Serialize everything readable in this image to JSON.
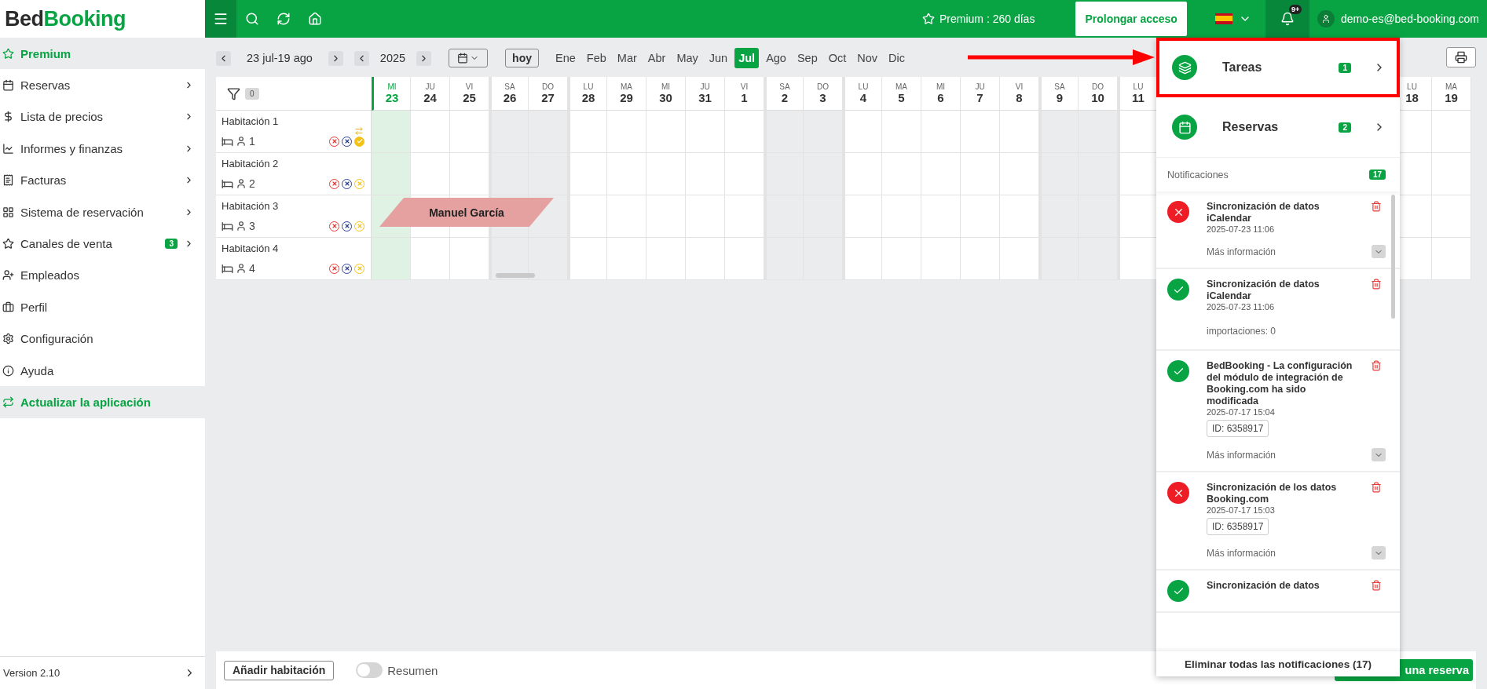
{
  "logo": {
    "dark": "Bed",
    "green": "Booking"
  },
  "topbar": {
    "premium": "Premium : 260 días",
    "extend_button": "Prolongar acceso",
    "notifications_badge": "9+",
    "notifications_open": true,
    "user": "demo-es@bed-booking.com"
  },
  "sidebar": {
    "items": [
      {
        "label": "Premium",
        "highlighted": true,
        "submenu": false
      },
      {
        "label": "Reservas",
        "highlighted": false,
        "submenu": true
      },
      {
        "label": "Lista de precios",
        "highlighted": false,
        "submenu": true
      },
      {
        "label": "Informes y finanzas",
        "highlighted": false,
        "submenu": true
      },
      {
        "label": "Facturas",
        "highlighted": false,
        "submenu": true
      },
      {
        "label": "Sistema de reservación",
        "highlighted": false,
        "submenu": true
      },
      {
        "label": "Canales de venta",
        "highlighted": false,
        "submenu": true,
        "badge": "3"
      },
      {
        "label": "Empleados",
        "highlighted": false,
        "submenu": false
      },
      {
        "label": "Perfil",
        "highlighted": false,
        "submenu": false
      },
      {
        "label": "Configuración",
        "highlighted": false,
        "submenu": false
      },
      {
        "label": "Ayuda",
        "highlighted": false,
        "submenu": false
      },
      {
        "label": "Actualizar la aplicación",
        "highlighted": true,
        "submenu": false
      }
    ],
    "version": "Version 2.10"
  },
  "toolbar": {
    "range": "23 jul-19 ago",
    "year": "2025",
    "today_button": "hoy",
    "months": [
      {
        "label": "Ene",
        "selected": false
      },
      {
        "label": "Feb",
        "selected": false
      },
      {
        "label": "Mar",
        "selected": false
      },
      {
        "label": "Abr",
        "selected": false
      },
      {
        "label": "May",
        "selected": false
      },
      {
        "label": "Jun",
        "selected": false
      },
      {
        "label": "Jul",
        "selected": true
      },
      {
        "label": "Ago",
        "selected": false
      },
      {
        "label": "Sep",
        "selected": false
      },
      {
        "label": "Oct",
        "selected": false
      },
      {
        "label": "Nov",
        "selected": false
      },
      {
        "label": "Dic",
        "selected": false
      }
    ]
  },
  "calendar": {
    "filter_count": "0",
    "days": [
      {
        "weekday": "MI",
        "day": "23",
        "weekend": false,
        "selected": true
      },
      {
        "weekday": "JU",
        "day": "24",
        "weekend": false,
        "selected": false
      },
      {
        "weekday": "VI",
        "day": "25",
        "weekend": false,
        "selected": false
      },
      {
        "weekday": "SA",
        "day": "26",
        "weekend": true,
        "selected": false
      },
      {
        "weekday": "DO",
        "day": "27",
        "weekend": true,
        "selected": false
      },
      {
        "weekday": "LU",
        "day": "28",
        "weekend": false,
        "selected": false
      },
      {
        "weekday": "MA",
        "day": "29",
        "weekend": false,
        "selected": false
      },
      {
        "weekday": "MI",
        "day": "30",
        "weekend": false,
        "selected": false
      },
      {
        "weekday": "JU",
        "day": "31",
        "weekend": false,
        "selected": false
      },
      {
        "weekday": "VI",
        "day": "1",
        "weekend": false,
        "selected": false
      },
      {
        "weekday": "SA",
        "day": "2",
        "weekend": true,
        "selected": false
      },
      {
        "weekday": "DO",
        "day": "3",
        "weekend": true,
        "selected": false
      },
      {
        "weekday": "LU",
        "day": "4",
        "weekend": false,
        "selected": false
      },
      {
        "weekday": "MA",
        "day": "5",
        "weekend": false,
        "selected": false
      },
      {
        "weekday": "MI",
        "day": "6",
        "weekend": false,
        "selected": false
      },
      {
        "weekday": "JU",
        "day": "7",
        "weekend": false,
        "selected": false
      },
      {
        "weekday": "VI",
        "day": "8",
        "weekend": false,
        "selected": false
      },
      {
        "weekday": "SA",
        "day": "9",
        "weekend": true,
        "selected": false
      },
      {
        "weekday": "DO",
        "day": "10",
        "weekend": true,
        "selected": false
      },
      {
        "weekday": "LU",
        "day": "11",
        "weekend": false,
        "selected": false
      },
      {
        "weekday": "LU",
        "day": "18",
        "weekend": false,
        "selected": false
      },
      {
        "weekday": "MA",
        "day": "19",
        "weekend": false,
        "selected": false
      }
    ],
    "rooms": [
      {
        "name": "Habitación 1",
        "capacity": "1",
        "transfer": true,
        "statuses": [
          {
            "color": "#e53935",
            "ok": false
          },
          {
            "color": "#2a3f8f",
            "ok": false
          },
          {
            "color": "#f2c218",
            "ok": true
          }
        ]
      },
      {
        "name": "Habitación 2",
        "capacity": "2",
        "transfer": false,
        "statuses": [
          {
            "color": "#e53935",
            "ok": false
          },
          {
            "color": "#2a3f8f",
            "ok": false
          },
          {
            "color": "#f2c218",
            "ok": false
          }
        ]
      },
      {
        "name": "Habitación 3",
        "capacity": "3",
        "transfer": false,
        "statuses": [
          {
            "color": "#e53935",
            "ok": false
          },
          {
            "color": "#2a3f8f",
            "ok": false
          },
          {
            "color": "#f2c218",
            "ok": false
          }
        ],
        "booking": {
          "guest": "Manuel García"
        }
      },
      {
        "name": "Habitación 4",
        "capacity": "4",
        "transfer": false,
        "statuses": [
          {
            "color": "#e53935",
            "ok": false
          },
          {
            "color": "#2a3f8f",
            "ok": false
          },
          {
            "color": "#f2c218",
            "ok": false
          }
        ]
      }
    ]
  },
  "bottom_bar": {
    "add_room_button": "Añadir habitación",
    "summary_toggle": {
      "label": "Resumen",
      "on": false
    },
    "new_booking_button": "una reserva"
  },
  "panel": {
    "sections": [
      {
        "label": "Tareas",
        "count": "1",
        "highlighted": true
      },
      {
        "label": "Reservas",
        "count": "2",
        "highlighted": false
      }
    ],
    "notifications_title": "Notificaciones",
    "notifications_count": "17",
    "notifications": [
      {
        "kind": "error",
        "title": "Sincronización de datos iCalendar",
        "time": "2025-07-23 11:06",
        "more": "Más información"
      },
      {
        "kind": "ok",
        "title": "Sincronización de datos iCalendar",
        "time": "2025-07-23 11:06",
        "details": "importaciones: 0"
      },
      {
        "kind": "ok",
        "title": "BedBooking - La configuración del módulo de integración de Booking.com ha sido modificada",
        "time": "2025-07-17 15:04",
        "id": "ID: 6358917",
        "more": "Más información"
      },
      {
        "kind": "error",
        "title": "Sincronización de los datos Booking.com",
        "time": "2025-07-17 15:03",
        "id": "ID: 6358917",
        "more": "Más información"
      },
      {
        "kind": "ok",
        "title": "Sincronización de datos"
      }
    ],
    "clear_button": "Eliminar todas las notificaciones (17)"
  }
}
